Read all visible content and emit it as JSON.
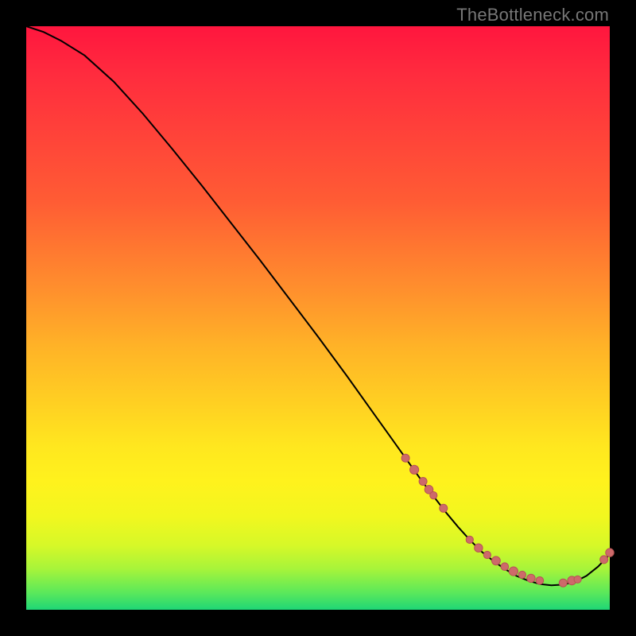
{
  "watermark": "TheBottleneck.com",
  "colors": {
    "marker_fill": "#cd6a6a",
    "marker_stroke": "#b75454",
    "line": "#000000",
    "bg": "#000000"
  },
  "chart_data": {
    "type": "line",
    "title": "",
    "xlabel": "",
    "ylabel": "",
    "xlim": [
      0,
      100
    ],
    "ylim": [
      0,
      100
    ],
    "grid": false,
    "legend": false,
    "series": [
      {
        "name": "bottleneck-curve",
        "x": [
          0,
          3,
          6,
          10,
          15,
          20,
          25,
          30,
          35,
          40,
          45,
          50,
          55,
          60,
          62,
          64,
          66,
          68,
          70,
          72,
          74,
          76,
          78,
          80,
          82,
          84,
          86,
          88,
          90,
          92,
          94,
          96,
          98,
          100
        ],
        "values": [
          100,
          99,
          97.5,
          95,
          90.5,
          85,
          79,
          72.8,
          66.4,
          60,
          53.4,
          46.8,
          40,
          33,
          30.2,
          27.4,
          24.6,
          21.8,
          19.2,
          16.6,
          14.2,
          12,
          10,
          8.4,
          7,
          5.8,
          5,
          4.4,
          4.2,
          4.3,
          4.8,
          5.8,
          7.4,
          9.5
        ]
      }
    ],
    "markers": [
      {
        "name": "cluster-a",
        "points": [
          {
            "x": 65,
            "y": 26,
            "r": 5
          },
          {
            "x": 66.5,
            "y": 24,
            "r": 5.6
          },
          {
            "x": 68,
            "y": 22,
            "r": 5
          },
          {
            "x": 69,
            "y": 20.6,
            "r": 5.3
          },
          {
            "x": 69.8,
            "y": 19.6,
            "r": 4.6
          },
          {
            "x": 71.5,
            "y": 17.4,
            "r": 5
          }
        ]
      },
      {
        "name": "cluster-b",
        "points": [
          {
            "x": 76,
            "y": 12,
            "r": 4.6
          },
          {
            "x": 77.5,
            "y": 10.6,
            "r": 5.2
          },
          {
            "x": 79,
            "y": 9.4,
            "r": 4.6
          },
          {
            "x": 80.5,
            "y": 8.4,
            "r": 5.4
          },
          {
            "x": 82,
            "y": 7.4,
            "r": 4.8
          },
          {
            "x": 83.5,
            "y": 6.6,
            "r": 5.6
          },
          {
            "x": 85,
            "y": 6,
            "r": 4.6
          },
          {
            "x": 86.5,
            "y": 5.4,
            "r": 5.2
          },
          {
            "x": 88,
            "y": 5,
            "r": 4.8
          }
        ]
      },
      {
        "name": "cluster-c",
        "points": [
          {
            "x": 92,
            "y": 4.6,
            "r": 5
          },
          {
            "x": 93.5,
            "y": 5,
            "r": 5.4
          },
          {
            "x": 94.5,
            "y": 5.2,
            "r": 4.6
          }
        ]
      },
      {
        "name": "cluster-d",
        "points": [
          {
            "x": 99,
            "y": 8.6,
            "r": 5
          },
          {
            "x": 100,
            "y": 9.8,
            "r": 5.2
          }
        ]
      }
    ]
  }
}
